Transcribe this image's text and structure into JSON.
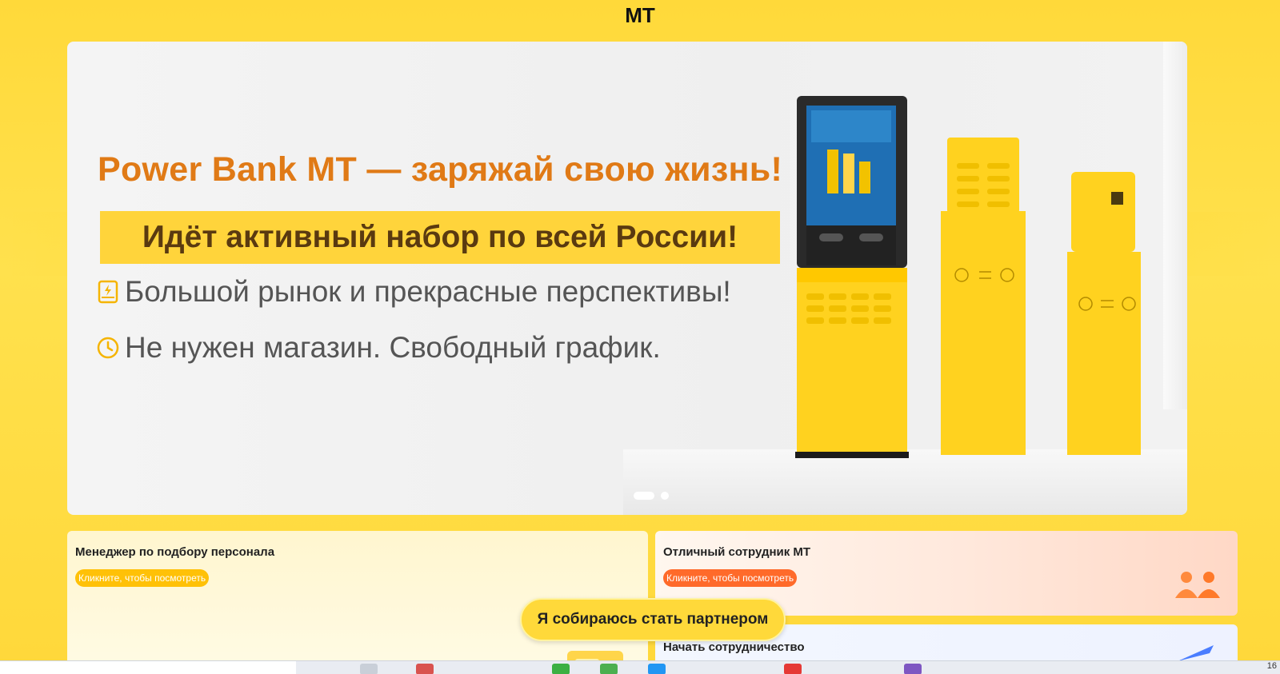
{
  "app": {
    "title": "MT"
  },
  "banner": {
    "headline": "Power Bank MT — заряжай свою жизнь!",
    "recruit": "Идёт активный набор по всей России!",
    "features": [
      {
        "icon": "power-bank-icon",
        "text": "Большой рынок и прекрасные перспективы!"
      },
      {
        "icon": "clock-icon",
        "text": "Не нужен магазин. Свободный график."
      }
    ],
    "carousel": {
      "slides": 2,
      "active": 1
    },
    "colors": {
      "headline": "#e07a16",
      "recruit_bg": "#ffd43b"
    }
  },
  "cards": {
    "left": {
      "title": "Менеджер по подбору персонала",
      "button": "Кликните, чтобы посмотреть"
    },
    "right": {
      "title": "Отличный сотрудник МТ",
      "button": "Кликните, чтобы посмотреть"
    },
    "bottom": {
      "title": "Начать сотрудничество"
    }
  },
  "cta": {
    "label": "Я собираюсь стать партнером"
  },
  "taskbar": {
    "clock": "16"
  },
  "colors": {
    "page_bg": "#ffd93a",
    "accent_orange": "#ff6a2a",
    "accent_yellow": "#ffc107"
  }
}
